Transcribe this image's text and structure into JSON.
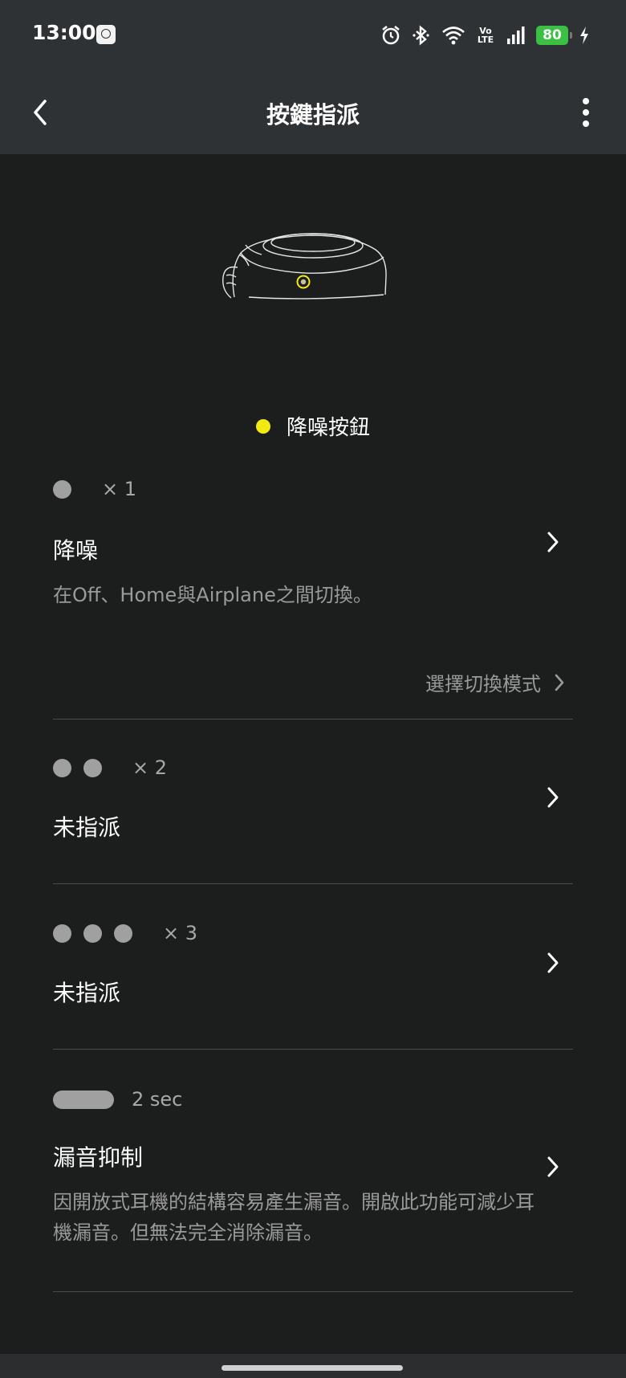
{
  "status_bar": {
    "time": "13:00",
    "network_label": "Vo\nLTE",
    "battery": "80",
    "icons": [
      "app-notification-icon",
      "alarm-icon",
      "bluetooth-icon",
      "wifi-icon",
      "volte-icon",
      "signal-icon",
      "battery-icon",
      "charging-icon"
    ]
  },
  "app_bar": {
    "title": "按鍵指派",
    "back_icon": "back-arrow-icon",
    "menu_icon": "more-vert-icon"
  },
  "hero": {
    "image": "earbud-illustration",
    "button_name": "降噪按鈕",
    "indicator_color": "#f3ea11"
  },
  "assignments": [
    {
      "pattern": "single-tap",
      "count_label": "× 1",
      "title": "降噪",
      "description": "在Off、Home與Airplane之間切換。",
      "link_label": "選擇切換模式"
    },
    {
      "pattern": "double-tap",
      "count_label": "× 2",
      "title": "未指派"
    },
    {
      "pattern": "triple-tap",
      "count_label": "× 3",
      "title": "未指派"
    },
    {
      "pattern": "long-press",
      "count_label": "2 sec",
      "title": "漏音抑制",
      "description": "因開放式耳機的結構容易產生漏音。開啟此功能可減少耳機漏音。但無法完全消除漏音。"
    }
  ],
  "colors": {
    "background": "#1c1d1d",
    "bar": "#2f3234",
    "accent_yellow": "#f3ea11",
    "battery_green": "#3bbf45",
    "muted_text": "#9a9a9a"
  }
}
